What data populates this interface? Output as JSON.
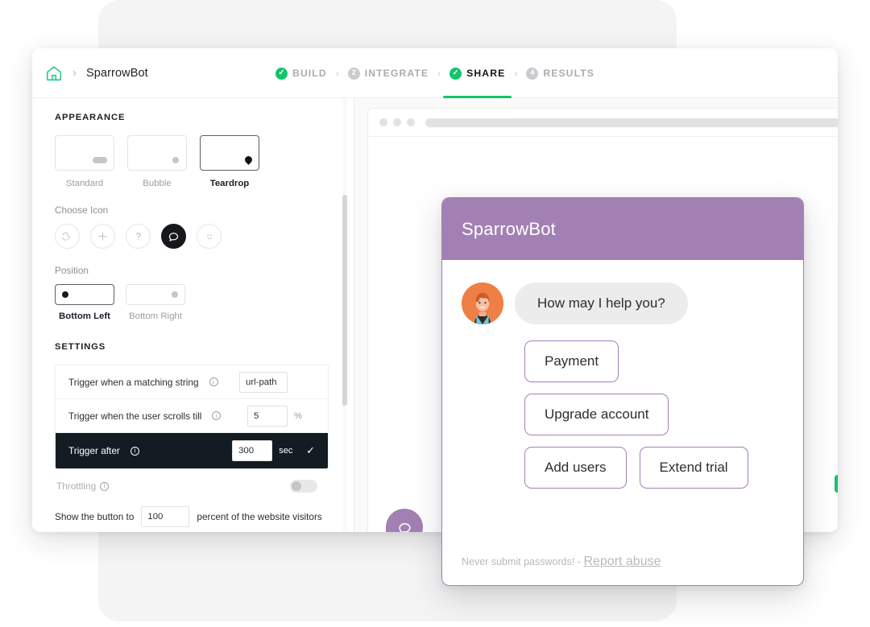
{
  "window": {
    "breadcrumb": {
      "home_icon": "home-icon",
      "separator": "›",
      "title": "SparrowBot"
    },
    "steps": [
      {
        "badge": "✓",
        "label": "BUILD",
        "state": "done"
      },
      {
        "badge": "2",
        "label": "INTEGRATE",
        "state": "pending"
      },
      {
        "badge": "✓",
        "label": "SHARE",
        "state": "active"
      },
      {
        "badge": "4",
        "label": "RESULTS",
        "state": "pending"
      }
    ],
    "step_separator": "›"
  },
  "appearance": {
    "section_title": "APPEARANCE",
    "themes": [
      {
        "label": "Standard",
        "selected": false,
        "shape": "pill"
      },
      {
        "label": "Bubble",
        "selected": false,
        "shape": "circle"
      },
      {
        "label": "Teardrop",
        "selected": true,
        "shape": "teardrop"
      }
    ],
    "choose_icon_label": "Choose Icon",
    "icons": [
      {
        "name": "sparrow-icon",
        "selected": false
      },
      {
        "name": "plus-icon",
        "selected": false
      },
      {
        "name": "question-icon",
        "selected": false
      },
      {
        "name": "chat-bubble-icon",
        "selected": true
      },
      {
        "name": "smiley-icon",
        "selected": false
      }
    ],
    "position_label": "Position",
    "positions": [
      {
        "label": "Bottom Left",
        "selected": true
      },
      {
        "label": "Bottom Right",
        "selected": false
      }
    ]
  },
  "settings": {
    "section_title": "SETTINGS",
    "rows": [
      {
        "label": "Trigger when a matching string",
        "value": "url-path",
        "unit": "",
        "highlighted": false,
        "checked": false
      },
      {
        "label": "Trigger when the user scrolls till",
        "value": "5",
        "unit": "%",
        "highlighted": false,
        "checked": false
      },
      {
        "label": "Trigger after",
        "value": "300",
        "unit": "sec",
        "highlighted": true,
        "checked": true
      }
    ],
    "throttling_label": "Throttling",
    "throttling_on": false,
    "visitors_prefix": "Show the button to",
    "visitors_value": "100",
    "visitors_suffix": "percent of the website visitors"
  },
  "preview": {
    "browser_dots": 3,
    "launcher_icon": "chat-bubble-icon"
  },
  "chat": {
    "title": "SparrowBot",
    "accent_color": "#a380b4",
    "avatar_name": "agent-avatar",
    "message": "How may I help you?",
    "options_rows": [
      [
        "Payment"
      ],
      [
        "Upgrade account"
      ],
      [
        "Add users",
        "Extend trial"
      ]
    ],
    "footer_text": "Never submit passwords! - ",
    "footer_link": "Report abuse"
  }
}
